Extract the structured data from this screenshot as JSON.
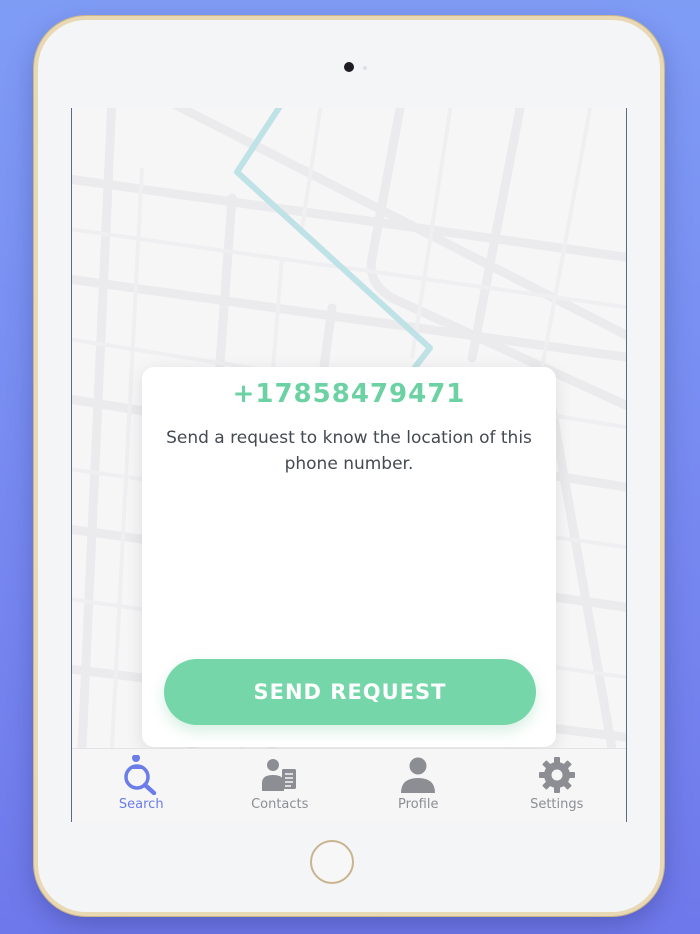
{
  "request_card": {
    "phone_number": "+17858479471",
    "message": "Send a request to know the location of this phone number.",
    "send_button_label": "SEND REQUEST"
  },
  "tabbar": {
    "tabs": [
      {
        "label": "Search",
        "icon": "search-person-icon",
        "active": true
      },
      {
        "label": "Contacts",
        "icon": "contacts-icon",
        "active": false
      },
      {
        "label": "Profile",
        "icon": "profile-icon",
        "active": false
      },
      {
        "label": "Settings",
        "icon": "gear-icon",
        "active": false
      }
    ]
  },
  "colors": {
    "accent_green": "#74d6a9",
    "phone_green": "#6cd2a3",
    "active_tab": "#6a7de8",
    "inactive_tab": "#8c8e93",
    "route": "#bfe2e6",
    "background": "#7687f0"
  }
}
